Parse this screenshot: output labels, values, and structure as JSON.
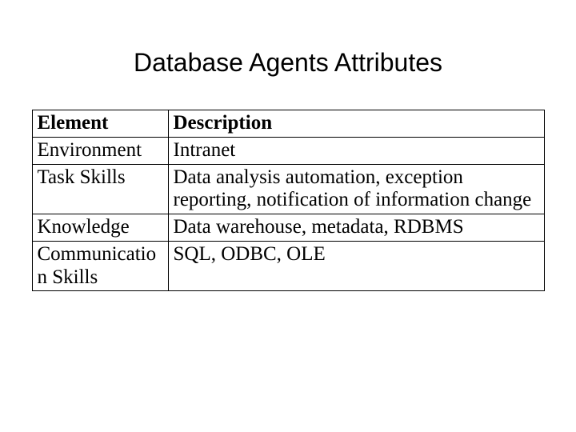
{
  "title": "Database Agents Attributes",
  "table": {
    "header": {
      "element": "Element",
      "description": "Description"
    },
    "rows": [
      {
        "element": "Environment",
        "description": "Intranet"
      },
      {
        "element": "Task Skills",
        "description": "Data analysis automation, exception reporting, notification of information change"
      },
      {
        "element": "Knowledge",
        "description": "Data warehouse, metadata, RDBMS"
      },
      {
        "element": "Communication Skills",
        "description": "SQL, ODBC, OLE"
      }
    ]
  }
}
